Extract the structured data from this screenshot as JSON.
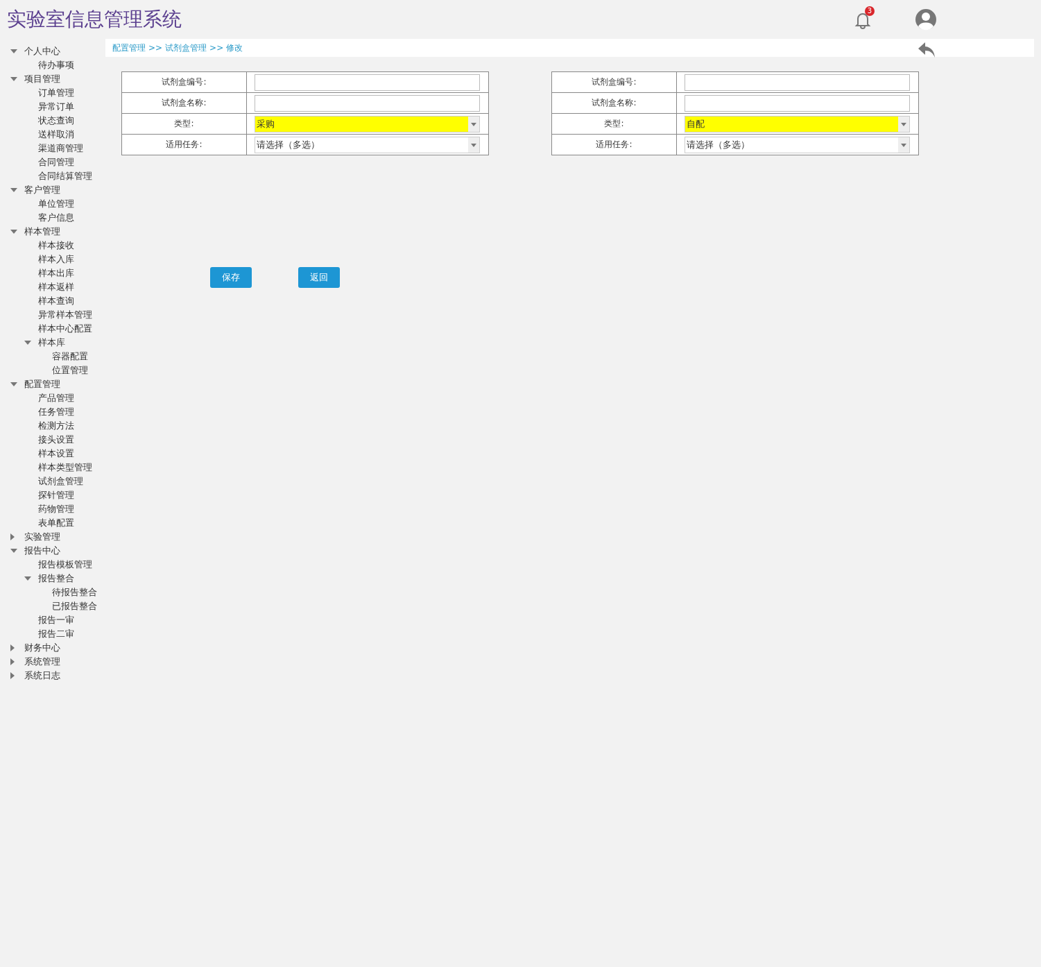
{
  "header": {
    "title": "实验室信息管理系统",
    "notification_count": "3"
  },
  "sidebar": {
    "items": [
      {
        "label": "个人中心",
        "expanded": true,
        "children": [
          {
            "label": "待办事项"
          }
        ]
      },
      {
        "label": "项目管理",
        "expanded": true,
        "children": [
          {
            "label": "订单管理"
          },
          {
            "label": "异常订单"
          },
          {
            "label": "状态查询"
          },
          {
            "label": "送样取消"
          },
          {
            "label": "渠道商管理"
          },
          {
            "label": "合同管理"
          },
          {
            "label": "合同结算管理"
          }
        ]
      },
      {
        "label": "客户管理",
        "expanded": true,
        "children": [
          {
            "label": "单位管理"
          },
          {
            "label": "客户信息"
          }
        ]
      },
      {
        "label": "样本管理",
        "expanded": true,
        "children": [
          {
            "label": "样本接收"
          },
          {
            "label": "样本入库"
          },
          {
            "label": "样本出库"
          },
          {
            "label": "样本返样"
          },
          {
            "label": "样本查询"
          },
          {
            "label": "异常样本管理"
          },
          {
            "label": "样本中心配置"
          },
          {
            "label": "样本库",
            "expanded": true,
            "children": [
              {
                "label": "容器配置"
              },
              {
                "label": "位置管理"
              }
            ]
          }
        ]
      },
      {
        "label": "配置管理",
        "expanded": true,
        "children": [
          {
            "label": "产品管理"
          },
          {
            "label": "任务管理"
          },
          {
            "label": "检测方法"
          },
          {
            "label": "接头设置"
          },
          {
            "label": "样本设置"
          },
          {
            "label": "样本类型管理"
          },
          {
            "label": "试剂盒管理"
          },
          {
            "label": "探针管理"
          },
          {
            "label": "药物管理"
          },
          {
            "label": "表单配置"
          }
        ]
      },
      {
        "label": "实验管理",
        "expanded": false
      },
      {
        "label": "报告中心",
        "expanded": true,
        "children": [
          {
            "label": "报告模板管理"
          },
          {
            "label": "报告整合",
            "expanded": true,
            "children": [
              {
                "label": "待报告整合"
              },
              {
                "label": "已报告整合"
              }
            ]
          },
          {
            "label": "报告一审"
          },
          {
            "label": "报告二审"
          }
        ]
      },
      {
        "label": "财务中心",
        "expanded": false
      },
      {
        "label": "系统管理",
        "expanded": false
      },
      {
        "label": "系统日志",
        "expanded": false
      }
    ]
  },
  "breadcrumb": [
    "配置管理",
    "试剂盒管理",
    "修改"
  ],
  "breadcrumb_separator": ">>",
  "forms": [
    {
      "rows": [
        {
          "label": "试剂盒编号:",
          "kind": "text",
          "highlighted": false
        },
        {
          "label": "试剂盒名称:",
          "kind": "text",
          "highlighted": false
        },
        {
          "label": "类型:",
          "kind": "select",
          "value": "采购",
          "highlighted": true
        },
        {
          "label": "适用任务:",
          "kind": "select",
          "value": "请选择（多选）",
          "highlighted": false
        }
      ]
    },
    {
      "rows": [
        {
          "label": "试剂盒编号:",
          "kind": "text",
          "highlighted": false
        },
        {
          "label": "试剂盒名称:",
          "kind": "text",
          "highlighted": false
        },
        {
          "label": "类型:",
          "kind": "select",
          "value": "自配",
          "highlighted": true
        },
        {
          "label": "适用任务:",
          "kind": "select",
          "value": "请选择（多选）",
          "highlighted": false
        }
      ]
    }
  ],
  "buttons": [
    "保存",
    "返回"
  ]
}
